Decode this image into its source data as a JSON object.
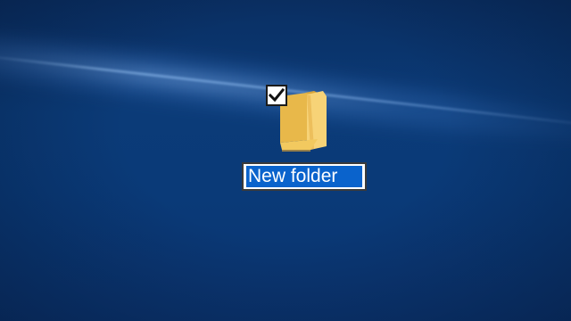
{
  "desktop": {
    "background_colors": [
      "#0a2f63",
      "#0b3b78",
      "#0a3a78"
    ],
    "items": [
      {
        "icon": "folder-icon",
        "selected": true,
        "checkbox_checked": true,
        "rename_value": "New folder",
        "selection_color": "#0a63cc"
      }
    ]
  }
}
